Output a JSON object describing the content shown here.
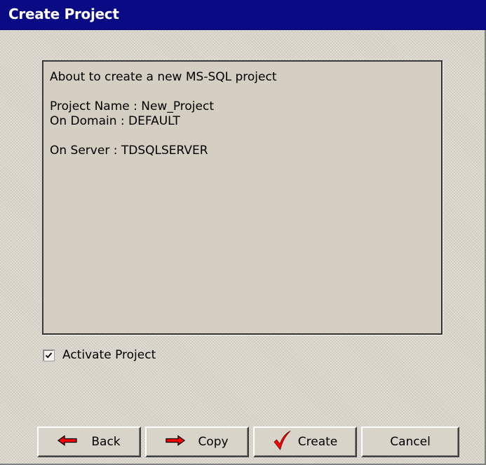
{
  "window": {
    "title": "Create Project"
  },
  "info": {
    "line1": "About to create a new MS-SQL project",
    "line2": "Project Name : New_Project",
    "line3": "On Domain : DEFAULT",
    "line4": "On Server : TDSQLSERVER"
  },
  "activate": {
    "label": "Activate Project",
    "checked": true
  },
  "buttons": {
    "back": "Back",
    "copy": "Copy",
    "create": "Create",
    "cancel": "Cancel"
  },
  "colors": {
    "titlebar": "#0a0a84",
    "arrow": "#ff0000",
    "checkmark": "#ff0000"
  },
  "icons": {
    "back": "left-arrow-icon",
    "copy": "right-arrow-icon",
    "create": "checkmark-icon"
  }
}
